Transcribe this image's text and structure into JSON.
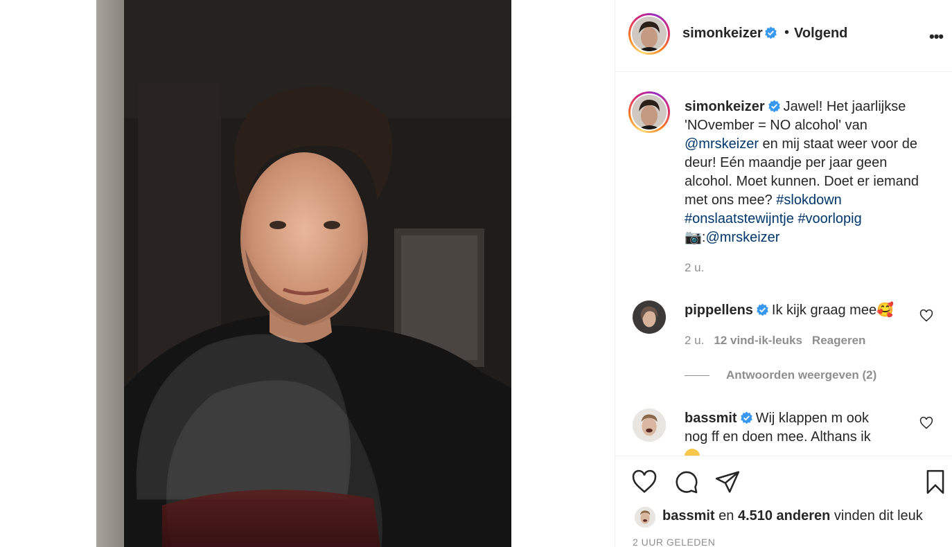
{
  "post": {
    "author": "simonkeizer",
    "follow_status": "Volgend",
    "dot": "•",
    "more": "•••"
  },
  "caption": {
    "username": "simonkeizer",
    "text_1": "Jawel! Het jaarlijkse",
    "text_2": "'NOvember = NO alcohol' van",
    "mention_1": "@mrskeizer",
    "text_3": " en mij staat weer voor de",
    "text_4": "deur! Eén maandje per jaar geen",
    "text_5": "alcohol. Moet kunnen. Doet er iemand",
    "text_6": "met ons mee? ",
    "hashtag_1": "#slokdown",
    "hashtag_2": "#onslaatstewijntje",
    "hashtag_3": "#voorlopig",
    "camera_emoji": "📷",
    "colon": ":",
    "mention_2": "@mrskeizer",
    "time": "2 u."
  },
  "comments": [
    {
      "username": "pippellens",
      "text": "Ik kijk graag mee",
      "emoji": "🥰",
      "time": "2 u.",
      "likes": "12 vind-ik-leuks",
      "reply": "Reageren",
      "view_replies": "Antwoorden weergeven (2)"
    },
    {
      "username": "bassmit",
      "text_1": "Wij klappen m ook",
      "text_2": "nog ff en doen mee. Althans ik"
    }
  ],
  "likes": {
    "user": "bassmit",
    "connector": " en ",
    "count": "4.510 anderen",
    "suffix": " vinden dit leuk"
  },
  "timestamp": "2 UUR GELEDEN",
  "colors": {
    "link": "#00376b",
    "verified": "#3897f0",
    "muted": "#8e8e8e",
    "border": "#efefef"
  },
  "icons": [
    "heart-icon",
    "comment-icon",
    "share-icon",
    "bookmark-icon",
    "more-icon",
    "verified-icon"
  ]
}
